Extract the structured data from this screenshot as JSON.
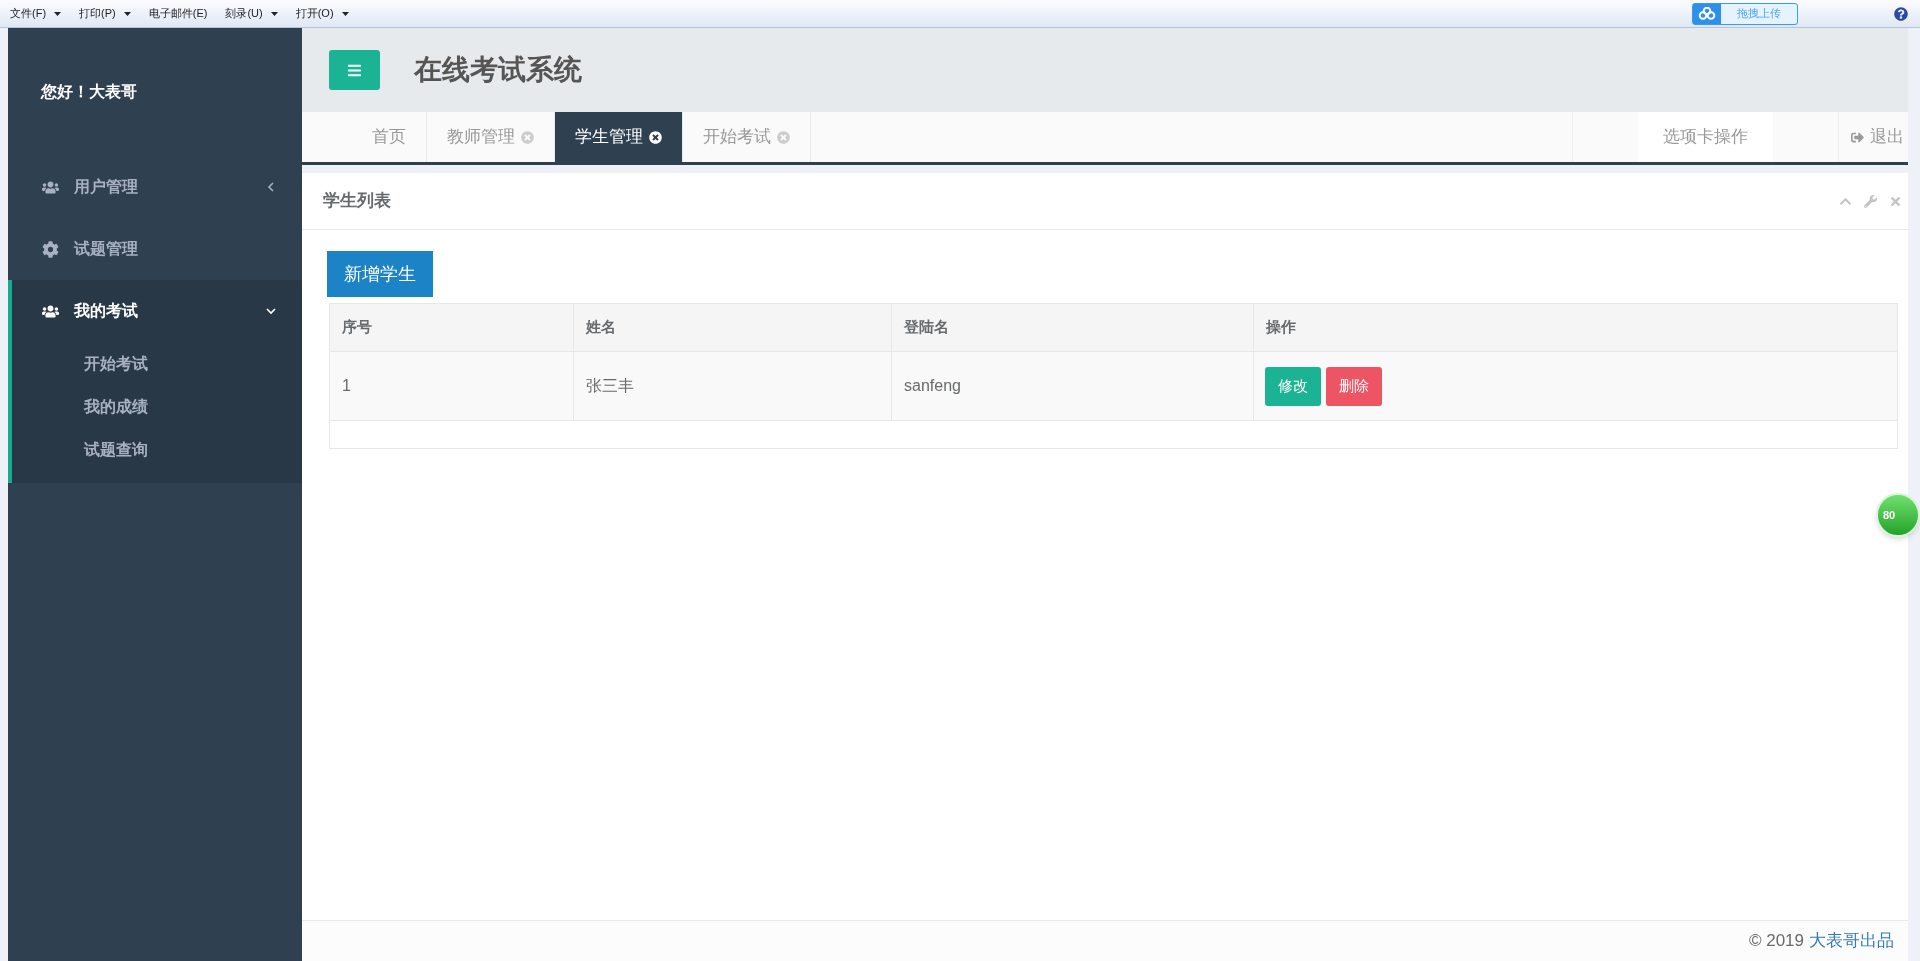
{
  "toolbar": {
    "menus": [
      {
        "label": "文件(F)",
        "has_dropdown": true
      },
      {
        "label": "打印(P)",
        "has_dropdown": true
      },
      {
        "label": "电子邮件(E)",
        "has_dropdown": false
      },
      {
        "label": "刻录(U)",
        "has_dropdown": true
      },
      {
        "label": "打开(O)",
        "has_dropdown": true
      }
    ],
    "upload_button": "拖拽上传"
  },
  "sidebar": {
    "greeting": "您好！大表哥",
    "items": [
      {
        "label": "用户管理",
        "kind": "group",
        "expanded": false,
        "selected": false
      },
      {
        "label": "试题管理",
        "kind": "link",
        "selected": false
      },
      {
        "label": "我的考试",
        "kind": "group",
        "expanded": true,
        "selected": true,
        "children": [
          {
            "label": "开始考试"
          },
          {
            "label": "我的成绩"
          },
          {
            "label": "试题查询"
          }
        ]
      }
    ]
  },
  "header": {
    "title": "在线考试系统"
  },
  "tabs": [
    {
      "label": "首页",
      "closable": false,
      "selected": false
    },
    {
      "label": "教师管理",
      "closable": true,
      "selected": false
    },
    {
      "label": "学生管理",
      "closable": true,
      "selected": true
    },
    {
      "label": "开始考试",
      "closable": true,
      "selected": false
    }
  ],
  "tab_actions": {
    "menu": "选项卡操作",
    "logout": "退出"
  },
  "panel": {
    "title": "学生列表",
    "add_button": "新增学生",
    "table": {
      "columns": [
        "序号",
        "姓名",
        "登陆名",
        "操作"
      ],
      "rows": [
        {
          "cells": [
            "1",
            "张三丰",
            "sanfeng"
          ],
          "actions": [
            {
              "label": "修改",
              "kind": "edit"
            },
            {
              "label": "删除",
              "kind": "delete"
            }
          ]
        }
      ]
    }
  },
  "floating_badge": "80",
  "footer": {
    "copyright": "© 2019",
    "link": "大表哥出品"
  }
}
